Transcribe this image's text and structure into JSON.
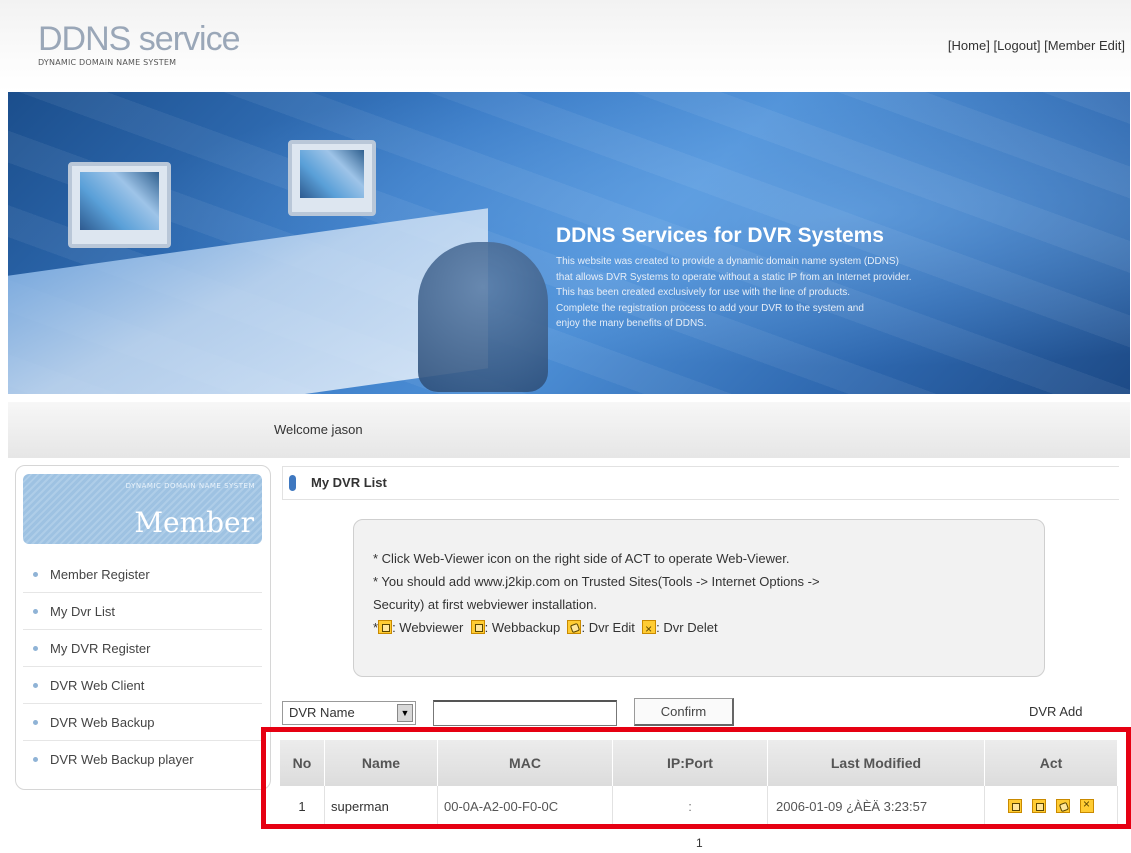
{
  "header": {
    "logo_main": "DDNS service",
    "logo_sub": "DYNAMIC DOMAIN NAME SYSTEM",
    "links": [
      "[Home]",
      "[Logout]",
      "[Member Edit]"
    ]
  },
  "banner": {
    "title": "DDNS Services for DVR Systems",
    "lines": [
      "This website was created to provide a dynamic domain name system (DDNS)",
      "that allows DVR Systems to operate without a static IP from an Internet provider.",
      "This has been created exclusively for use with the line of products.",
      "Complete the registration process to add your DVR to the system and",
      "enjoy the many benefits of DDNS."
    ]
  },
  "welcome": "Welcome jason",
  "sidebar": {
    "box_sub": "DYNAMIC DOMAIN NAME SYSTEM",
    "box_title": "Member",
    "items": [
      {
        "label": "Member Register"
      },
      {
        "label": "My Dvr List"
      },
      {
        "label": "My DVR Register"
      },
      {
        "label": "DVR Web Client"
      },
      {
        "label": "DVR Web Backup"
      },
      {
        "label": "DVR Web Backup player"
      }
    ]
  },
  "main": {
    "section_title": "My DVR List",
    "notice": {
      "line1": "* Click Web-Viewer icon on the right side of ACT to operate Web-Viewer.",
      "line2": "* You should add www.j2kip.com on Trusted Sites(Tools -> Internet Options ->",
      "line3": "Security) at first webviewer installation.",
      "legend_prefix": "*",
      "legend_webviewer": ": Webviewer",
      "legend_webbackup": ": Webbackup",
      "legend_edit": ": Dvr Edit",
      "legend_delete": ": Dvr Delet"
    },
    "search": {
      "select_value": "DVR Name",
      "input_value": "",
      "confirm_label": "Confirm",
      "add_label": "DVR Add"
    },
    "table": {
      "headers": [
        "No",
        "Name",
        "MAC",
        "IP:Port",
        "Last Modified",
        "Act"
      ],
      "rows": [
        {
          "no": "1",
          "name": "superman",
          "mac": "00-0A-A2-00-F0-0C",
          "ipport": ":",
          "modified": "2006-01-09 ¿ÀÈÄ 3:23:57"
        }
      ]
    },
    "pagination": "1"
  },
  "colors": {
    "highlight_border": "#e60012",
    "accent_blue": "#3f78c0",
    "icon_fill": "#ffcc33"
  }
}
